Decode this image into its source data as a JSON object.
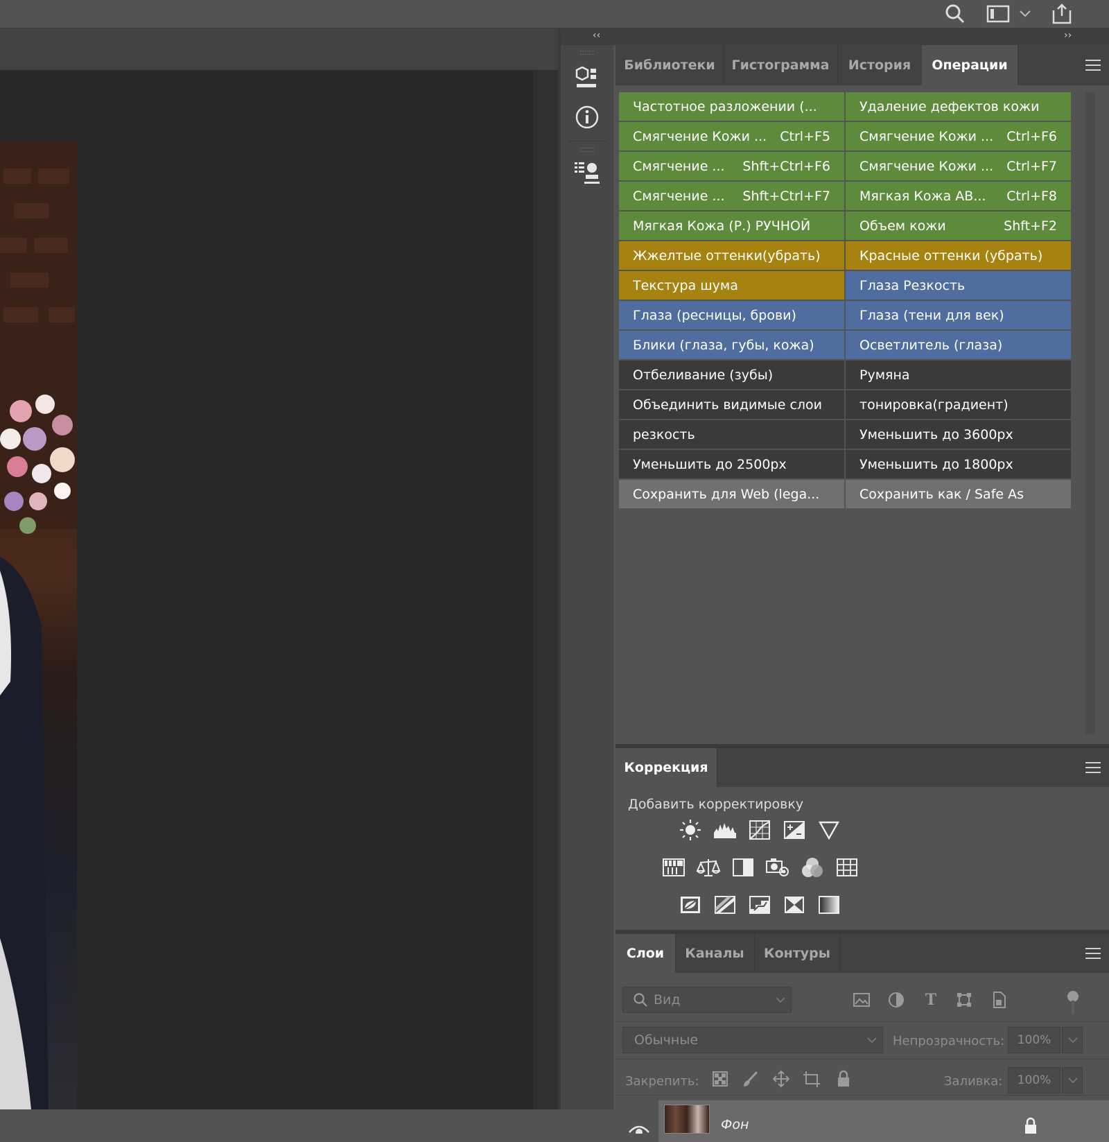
{
  "topbar": {
    "icons": [
      "search-icon",
      "workspace-icon",
      "chevron-down-icon",
      "share-icon"
    ]
  },
  "collapse": {
    "left": "‹‹",
    "right": "››"
  },
  "tabs": [
    {
      "label": "Библиотеки"
    },
    {
      "label": "Гистограмма"
    },
    {
      "label": "История"
    },
    {
      "label": "Операции",
      "active": true
    }
  ],
  "colors": {
    "green": "#5e8a3c",
    "yellow": "#a68310",
    "blue": "#4f6d9e",
    "dark": "#3a3a3a",
    "gray": "#707070"
  },
  "actions": [
    {
      "label": "Частотное разложении (...",
      "key": "",
      "color": "green"
    },
    {
      "label": "Удаление дефектов кожи",
      "key": "",
      "color": "green"
    },
    {
      "label": "Смягчение Кожи ...",
      "key": "Ctrl+F5",
      "color": "green"
    },
    {
      "label": "Смягчение Кожи ...",
      "key": "Ctrl+F6",
      "color": "green"
    },
    {
      "label": "Смягчение ...",
      "key": "Shft+Ctrl+F6",
      "color": "green"
    },
    {
      "label": "Смягчение Кожи ...",
      "key": "Ctrl+F7",
      "color": "green"
    },
    {
      "label": "Смягчение ...",
      "key": "Shft+Ctrl+F7",
      "color": "green"
    },
    {
      "label": "Мягкая Кожа АВ...",
      "key": "Ctrl+F8",
      "color": "green"
    },
    {
      "label": "Мягкая Кожа (Р.) РУЧНОЙ",
      "key": "",
      "color": "green"
    },
    {
      "label": "Объем кожи",
      "key": "Shft+F2",
      "color": "green"
    },
    {
      "label": "Жжелтые  оттенки(убрать)",
      "key": "",
      "color": "yellow"
    },
    {
      "label": "Красные оттенки (убрать)",
      "key": "",
      "color": "yellow"
    },
    {
      "label": "Текстура шума",
      "key": "",
      "color": "yellow"
    },
    {
      "label": "Глаза Резкость",
      "key": "",
      "color": "blue"
    },
    {
      "label": "Глаза (ресницы, брови)",
      "key": "",
      "color": "blue"
    },
    {
      "label": "Глаза (тени для век)",
      "key": "",
      "color": "blue"
    },
    {
      "label": "Блики (глаза, губы, кожа)",
      "key": "",
      "color": "blue"
    },
    {
      "label": "Осветлитель (глаза)",
      "key": "",
      "color": "blue"
    },
    {
      "label": "Отбеливание (зубы)",
      "key": "",
      "color": "dark"
    },
    {
      "label": "Румяна",
      "key": "",
      "color": "dark"
    },
    {
      "label": "Объединить видимые слои",
      "key": "",
      "color": "dark"
    },
    {
      "label": "тонировка(градиент)",
      "key": "",
      "color": "dark"
    },
    {
      "label": "резкость",
      "key": "",
      "color": "dark"
    },
    {
      "label": "Уменьшить до 3600px",
      "key": "",
      "color": "dark"
    },
    {
      "label": "Уменьшить до 2500px",
      "key": "",
      "color": "dark"
    },
    {
      "label": "Уменьшить до 1800px",
      "key": "",
      "color": "dark"
    },
    {
      "label": "Сохранить для Web (lega...",
      "key": "",
      "color": "gray"
    },
    {
      "label": "Сохранить как / Safe As",
      "key": "",
      "color": "gray"
    }
  ],
  "adjustments": {
    "tab": "Коррекция",
    "subtitle": "Добавить корректировку",
    "row1": [
      "brightness-icon",
      "levels-icon",
      "curves-icon",
      "exposure-icon",
      "vibrance-icon"
    ],
    "row2": [
      "hue-saturation-icon",
      "color-balance-icon",
      "black-white-icon",
      "photo-filter-icon",
      "channel-mixer-icon",
      "color-lookup-icon"
    ],
    "row3": [
      "invert-icon",
      "posterize-icon",
      "threshold-icon",
      "selective-color-icon",
      "gradient-map-icon"
    ]
  },
  "layers": {
    "tabs": [
      {
        "label": "Слои",
        "active": true
      },
      {
        "label": "Каналы"
      },
      {
        "label": "Контуры"
      }
    ],
    "filter_placeholder": "Вид",
    "blend_mode": "Обычные",
    "opacity_label": "Непрозрачность:",
    "opacity_value": "100%",
    "lock_label": "Закрепить:",
    "fill_label": "Заливка:",
    "fill_value": "100%",
    "layer_name": "Фон"
  }
}
